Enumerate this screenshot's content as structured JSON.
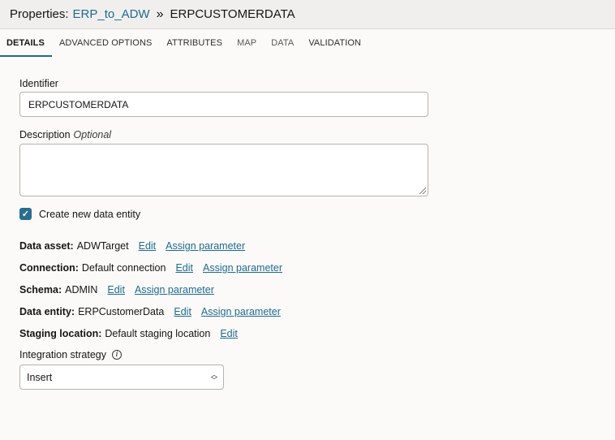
{
  "header": {
    "prefix": "Properties:",
    "link": "ERP_to_ADW",
    "separator": "»",
    "title": "ERPCUSTOMERDATA"
  },
  "tabs": [
    {
      "label": "DETAILS",
      "active": true
    },
    {
      "label": "ADVANCED OPTIONS"
    },
    {
      "label": "ATTRIBUTES"
    },
    {
      "label": "MAP"
    },
    {
      "label": "DATA"
    },
    {
      "label": "VALIDATION"
    }
  ],
  "form": {
    "identifier_label": "Identifier",
    "identifier_value": "ERPCUSTOMERDATA",
    "description_label": "Description",
    "description_optional": "Optional",
    "description_value": "",
    "create_entity_label": "Create new data entity",
    "create_entity_checked": true,
    "details": [
      {
        "key": "Data asset:",
        "value": "ADWTarget",
        "edit": "Edit",
        "assign": "Assign parameter"
      },
      {
        "key": "Connection:",
        "value": "Default connection",
        "edit": "Edit",
        "assign": "Assign parameter"
      },
      {
        "key": "Schema:",
        "value": "ADMIN",
        "edit": "Edit",
        "assign": "Assign parameter"
      },
      {
        "key": "Data entity:",
        "value": "ERPCustomerData",
        "edit": "Edit",
        "assign": "Assign parameter"
      },
      {
        "key": "Staging location:",
        "value": "Default staging location",
        "edit": "Edit"
      }
    ],
    "strategy_label": "Integration strategy",
    "strategy_value": "Insert"
  },
  "icons": {
    "info": "info-icon",
    "checkbox": "check-icon",
    "select": "chevron-updown-icon"
  },
  "colors": {
    "accent": "#1f6a92",
    "checkbox": "#2a6d8f"
  }
}
